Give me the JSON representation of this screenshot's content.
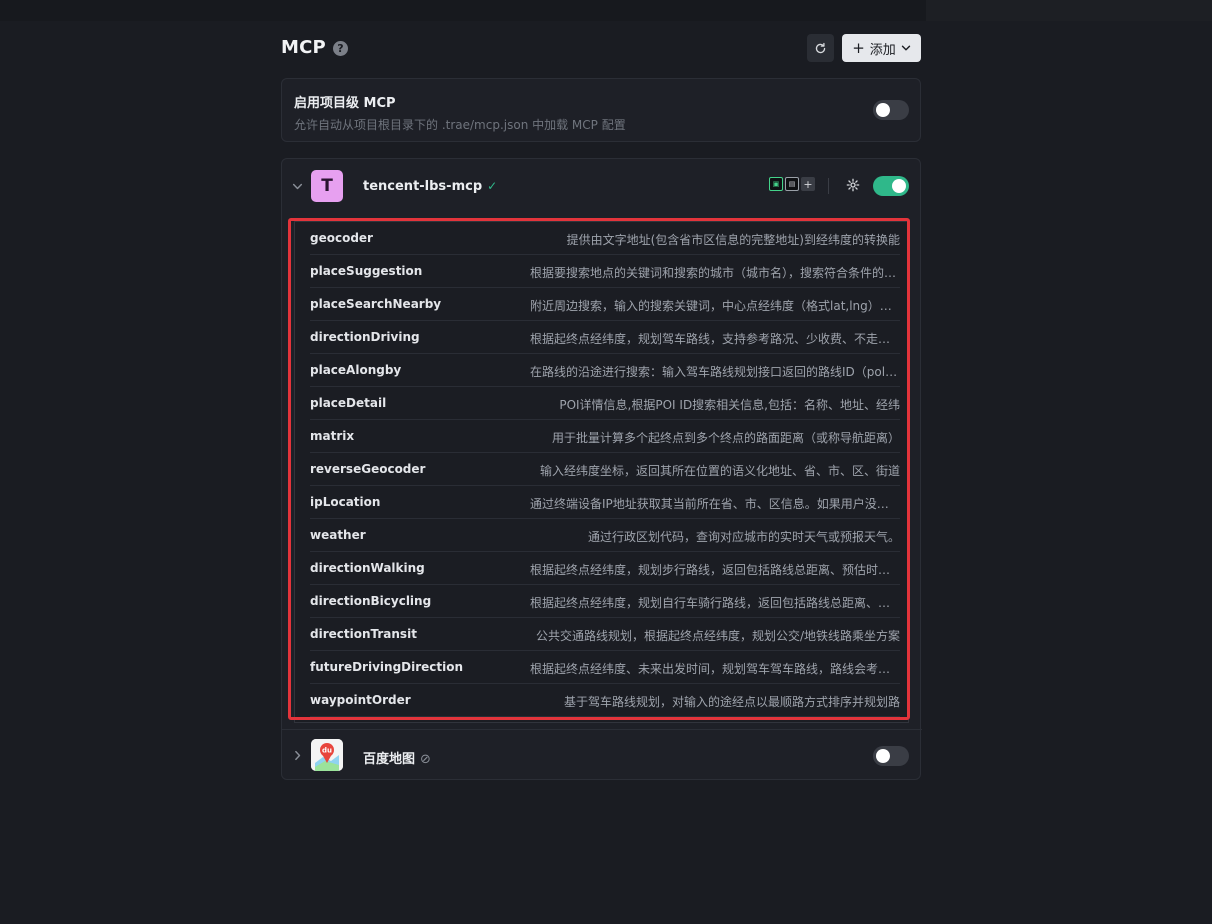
{
  "header": {
    "title": "MCP",
    "help_glyph": "?",
    "add_label": "添加",
    "add_plus": "+",
    "add_chevron": "⌄"
  },
  "project": {
    "title": "启用项目级 MCP",
    "subtitle": "允许自动从项目根目录下的 .trae/mcp.json 中加载 MCP 配置",
    "enabled": false
  },
  "servers": [
    {
      "name": "tencent-lbs-mcp",
      "avatar_letter": "T",
      "avatar_color": "#e7a0f0",
      "status_glyph": "✓",
      "expanded": true,
      "enabled": true,
      "tools": [
        {
          "name": "geocoder",
          "desc": "提供由文字地址(包含省市区信息的完整地址)到经纬度的转换能"
        },
        {
          "name": "placeSuggestion",
          "desc": "根据要搜索地点的关键词和搜索的城市（城市名），搜索符合条件的地点"
        },
        {
          "name": "placeSearchNearby",
          "desc": "附近周边搜索，输入的搜索关键词，中心点经纬度（格式lat,lng）和半径"
        },
        {
          "name": "directionDriving",
          "desc": "根据起终点经纬度，规划驾车路线，支持参考路况、少收费、不走高速"
        },
        {
          "name": "placeAlongby",
          "desc": "在路线的沿途进行搜索：输入驾车路线规划接口返回的路线ID（polyline）"
        },
        {
          "name": "placeDetail",
          "desc": "POI详情信息,根据POI ID搜索相关信息,包括：名称、地址、经纬"
        },
        {
          "name": "matrix",
          "desc": "用于批量计算多个起终点到多个终点的路面距离（或称导航距离）"
        },
        {
          "name": "reverseGeocoder",
          "desc": "输入经纬度坐标，返回其所在位置的语义化地址、省、市、区、街道"
        },
        {
          "name": "ipLocation",
          "desc": "通过终端设备IP地址获取其当前所在省、市、区信息。如果用户没有提供IP"
        },
        {
          "name": "weather",
          "desc": "通过行政区划代码，查询对应城市的实时天气或预报天气。"
        },
        {
          "name": "directionWalking",
          "desc": "根据起终点经纬度，规划步行路线，返回包括路线总距离、预估时间等"
        },
        {
          "name": "directionBicycling",
          "desc": "根据起终点经纬度，规划自行车骑行路线，返回包括路线总距离、预估时间"
        },
        {
          "name": "directionTransit",
          "desc": "公共交通路线规划，根据起终点经纬度，规划公交/地铁线路乘坐方案"
        },
        {
          "name": "futureDrivingDirection",
          "desc": "根据起终点经纬度、未来出发时间，规划驾车驾车路线，路线会考虑未来路况"
        },
        {
          "name": "waypointOrder",
          "desc": "基于驾车路线规划，对输入的途经点以最顺路方式排序并规划路"
        }
      ]
    },
    {
      "name": "百度地图",
      "avatar_letter": "du",
      "status_glyph": "⊘",
      "expanded": false,
      "enabled": false
    }
  ],
  "colors": {
    "accent_green": "#2fb88a",
    "highlight_red": "#e3343b",
    "background": "#1a1c22"
  }
}
